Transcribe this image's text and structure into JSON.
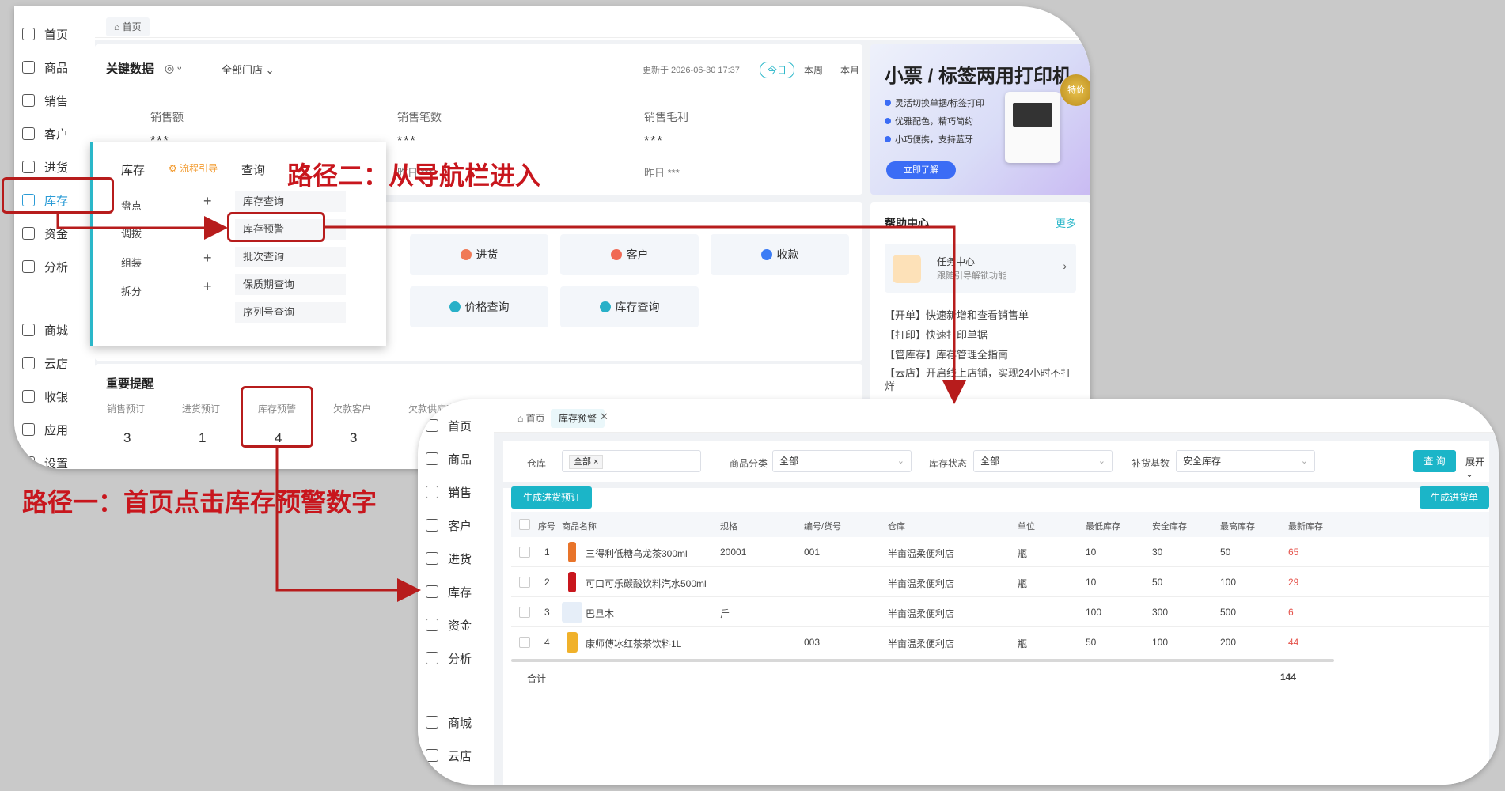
{
  "panel_a": {
    "sidebar": [
      {
        "label": "首页",
        "icon": "home-icon"
      },
      {
        "label": "商品",
        "icon": "goods-icon"
      },
      {
        "label": "销售",
        "icon": "sales-icon"
      },
      {
        "label": "客户",
        "icon": "customer-icon"
      },
      {
        "label": "进货",
        "icon": "purchase-icon"
      },
      {
        "label": "库存",
        "icon": "inventory-icon"
      },
      {
        "label": "资金",
        "icon": "funds-icon"
      },
      {
        "label": "分析",
        "icon": "analysis-icon"
      },
      {
        "label": "商城",
        "icon": "mall-icon"
      },
      {
        "label": "云店",
        "icon": "cloud-store-icon"
      },
      {
        "label": "收银",
        "icon": "cashier-icon"
      },
      {
        "label": "应用",
        "icon": "apps-icon"
      },
      {
        "label": "设置",
        "icon": "settings-icon"
      }
    ],
    "tab_home": "首页",
    "key_data": {
      "title": "关键数据",
      "store_filter": "全部门店",
      "updated": "更新于 2026-06-30 17:37",
      "range_today": "今日",
      "range_week": "本周",
      "range_month": "本月",
      "stats": [
        {
          "label": "销售额",
          "value": "***"
        },
        {
          "label": "销售笔数",
          "value": "***"
        },
        {
          "label": "销售毛利",
          "value": "***"
        }
      ],
      "yesterday": "昨日 ***",
      "yesterday_partial": "昨日 ***"
    },
    "flyout": {
      "col1_title": "库存",
      "guide": "流程引导",
      "col2_title": "查询",
      "col1_items": [
        "盘点",
        "调拨",
        "组装",
        "拆分"
      ],
      "col2_items": [
        "库存查询",
        "库存预警",
        "批次查询",
        "保质期查询",
        "序列号查询"
      ]
    },
    "quick": [
      "进货",
      "客户",
      "收款",
      "价格查询",
      "库存查询"
    ],
    "promo": {
      "title": "小票 / 标签两用打印机",
      "bullets": [
        "灵活切换单据/标签打印",
        "优雅配色，精巧简约",
        "小巧便携，支持蓝牙"
      ],
      "button": "立即了解",
      "badge": "特价"
    },
    "help": {
      "title": "帮助中心",
      "more": "更多",
      "task_title": "任务中心",
      "task_sub": "跟随引导解锁功能",
      "rows": [
        "【开单】快速新增和查看销售单",
        "【打印】快速打印单据",
        "【管库存】库存管理全指南",
        "【云店】开启线上店铺，实现24小时不打烊"
      ]
    },
    "reminders": {
      "title": "重要提醒",
      "items": [
        {
          "label": "销售预订",
          "value": "3"
        },
        {
          "label": "进货预订",
          "value": "1"
        },
        {
          "label": "库存预警",
          "value": "4"
        },
        {
          "label": "欠款客户",
          "value": "3"
        },
        {
          "label": "欠款供应商",
          "value": ""
        }
      ]
    }
  },
  "panel_b": {
    "sidebar": [
      {
        "label": "首页",
        "icon": "home-icon"
      },
      {
        "label": "商品",
        "icon": "goods-icon"
      },
      {
        "label": "销售",
        "icon": "sales-icon"
      },
      {
        "label": "客户",
        "icon": "customer-icon"
      },
      {
        "label": "进货",
        "icon": "purchase-icon"
      },
      {
        "label": "库存",
        "icon": "inventory-icon"
      },
      {
        "label": "资金",
        "icon": "funds-icon"
      },
      {
        "label": "分析",
        "icon": "analysis-icon"
      },
      {
        "label": "商城",
        "icon": "mall-icon"
      },
      {
        "label": "云店",
        "icon": "cloud-store-icon"
      }
    ],
    "tab_home": "首页",
    "tab_active": "库存预警",
    "filters": {
      "warehouse_label": "仓库",
      "warehouse_tag": "全部",
      "category_label": "商品分类",
      "category_value": "全部",
      "status_label": "库存状态",
      "status_value": "全部",
      "basis_label": "补货基数",
      "basis_value": "安全库存",
      "query_button": "查 询",
      "expand": "展开"
    },
    "actions": {
      "left": "生成进货预订",
      "right": "生成进货单"
    },
    "columns": [
      "序号",
      "商品名称",
      "规格",
      "编号/货号",
      "仓库",
      "单位",
      "最低库存",
      "安全库存",
      "最高库存",
      "最新库存"
    ],
    "rows": [
      {
        "no": "1",
        "name": "三得利低糖乌龙茶300ml",
        "spec": "20001",
        "code": "001",
        "warehouse": "半亩温柔便利店",
        "unit": "瓶",
        "min": "10",
        "safe": "30",
        "max": "50",
        "latest": "65"
      },
      {
        "no": "2",
        "name": "可口可乐碳酸饮料汽水500ml",
        "spec": "",
        "code": "",
        "warehouse": "半亩温柔便利店",
        "unit": "瓶",
        "min": "10",
        "safe": "50",
        "max": "100",
        "latest": "29"
      },
      {
        "no": "3",
        "name": "巴旦木",
        "spec": "斤",
        "code": "",
        "warehouse": "半亩温柔便利店",
        "unit": "",
        "min": "100",
        "safe": "300",
        "max": "500",
        "latest": "6"
      },
      {
        "no": "4",
        "name": "康师傅冰红茶茶饮料1L",
        "spec": "",
        "code": "003",
        "warehouse": "半亩温柔便利店",
        "unit": "瓶",
        "min": "50",
        "safe": "100",
        "max": "200",
        "latest": "44"
      }
    ],
    "total_label": "合计",
    "total_value": "144"
  },
  "annotations": {
    "path2": "路径二：从导航栏进入",
    "path1": "路径一：首页点击库存预警数字",
    "arrow_color": "#b71c1c"
  }
}
